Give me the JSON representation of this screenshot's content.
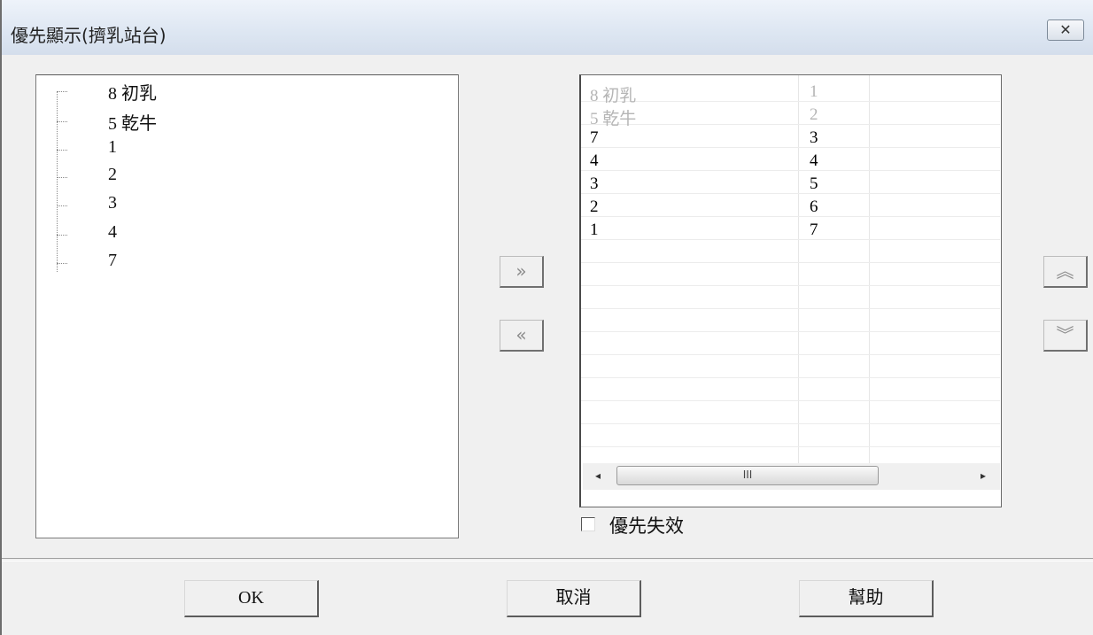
{
  "window": {
    "title": "優先顯示(擠乳站台)",
    "close_glyph": "✕"
  },
  "tree": {
    "items": [
      {
        "label": "8 初乳"
      },
      {
        "label": "5 乾牛"
      },
      {
        "label": "1"
      },
      {
        "label": "2"
      },
      {
        "label": "3"
      },
      {
        "label": "4"
      },
      {
        "label": "7"
      }
    ]
  },
  "transfer": {
    "add_label": "»",
    "remove_label": "«"
  },
  "priority_list": {
    "rows": [
      {
        "name": "8  初乳",
        "rank": "1",
        "enabled": false
      },
      {
        "name": "5  乾牛",
        "rank": "2",
        "enabled": false
      },
      {
        "name": "7",
        "rank": "3",
        "enabled": true
      },
      {
        "name": "4",
        "rank": "4",
        "enabled": true
      },
      {
        "name": "3",
        "rank": "5",
        "enabled": true
      },
      {
        "name": "2",
        "rank": "6",
        "enabled": true
      },
      {
        "name": "1",
        "rank": "7",
        "enabled": true
      }
    ],
    "scroll_left": "◂",
    "scroll_right": "▸",
    "scroll_grip": "III"
  },
  "reorder": {
    "up_label": "︽",
    "down_label": "︾"
  },
  "checkbox": {
    "label": "優先失效",
    "checked": false
  },
  "footer": {
    "ok_label": "OK",
    "cancel_label": "取消",
    "help_label": "幫助"
  },
  "icons": [
    "close-icon",
    "double-right-arrow-icon",
    "double-left-arrow-icon",
    "double-up-arrow-icon",
    "double-down-arrow-icon"
  ]
}
